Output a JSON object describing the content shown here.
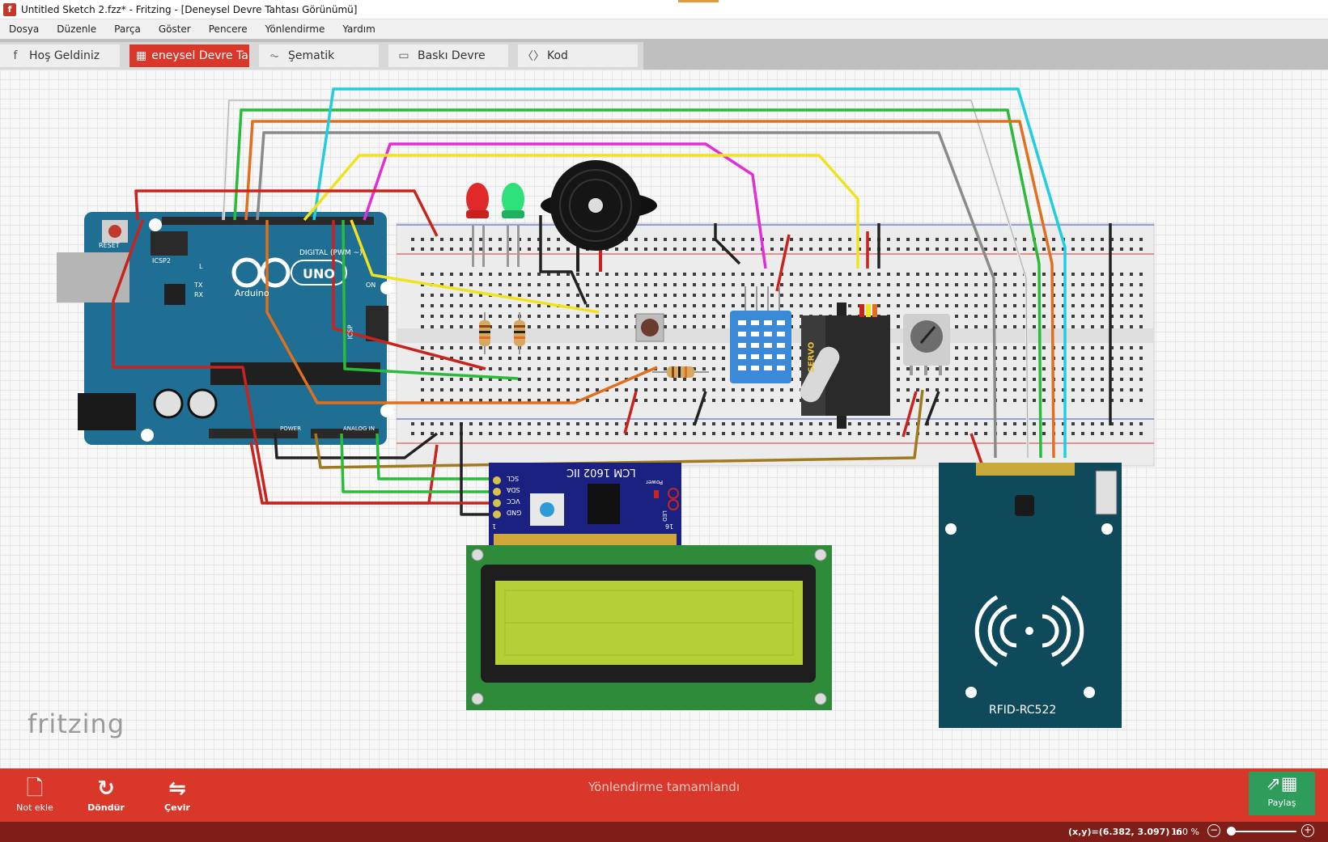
{
  "window": {
    "title": "Untitled Sketch 2.fzz* - Fritzing - [Deneysel Devre Tahtası Görünümü]",
    "logo_letter": "f"
  },
  "menu": {
    "items": [
      "Dosya",
      "Düzenle",
      "Parça",
      "Göster",
      "Pencere",
      "Yönlendirme",
      "Yardım"
    ]
  },
  "tabs": [
    {
      "label": "Hoş Geldiniz",
      "icon": "fritzing-f-icon",
      "glyph": "f"
    },
    {
      "label": "eneysel Devre Tahtası",
      "icon": "breadboard-icon",
      "glyph": "▦"
    },
    {
      "label": "Şematik",
      "icon": "schematic-icon",
      "glyph": "⏦"
    },
    {
      "label": "Baskı Devre",
      "icon": "pcb-icon",
      "glyph": "▭"
    },
    {
      "label": "Kod",
      "icon": "code-icon",
      "glyph": "〈〉"
    }
  ],
  "canvas": {
    "watermark": "fritzing",
    "arduino": {
      "logo_text": "UNO",
      "brand": "Arduino",
      "labels": {
        "reset": "RESET",
        "icsp2": "ICSP2",
        "icsp": "ICSP",
        "digital": "DIGITAL (PWM ~)",
        "power": "POWER",
        "analog": "ANALOG IN",
        "on": "ON",
        "l": "L",
        "tx": "TX",
        "rx": "RX"
      }
    },
    "lcd_module": {
      "title": "LCM 1602 IIC",
      "pins": [
        "SCL",
        "SDA",
        "VCC",
        "GND"
      ],
      "power": "Power",
      "led": "LED",
      "pin1": "1",
      "pin16": "16"
    },
    "servo_label": "SERVO",
    "rfid_label": "RFID-RC522",
    "colors": {
      "arduino": "#1f6f94",
      "breadboard": "#ececec",
      "lcd_pcb": "#2e8b3a",
      "lcd_screen": "#b5cf36",
      "lcd_module": "#1b2180",
      "rfid": "#0e4a5a",
      "dht": "#3a8ad8"
    }
  },
  "statusbar": {
    "add_note": "Not ekle",
    "rotate": "Döndür",
    "flip": "Çevir",
    "routing_status": "Yönlendirme tamamlandı",
    "share": "Paylaş"
  },
  "bottombar": {
    "coords": "(x,y)=(6.382, 3.097) in",
    "zoom": "160 %"
  }
}
